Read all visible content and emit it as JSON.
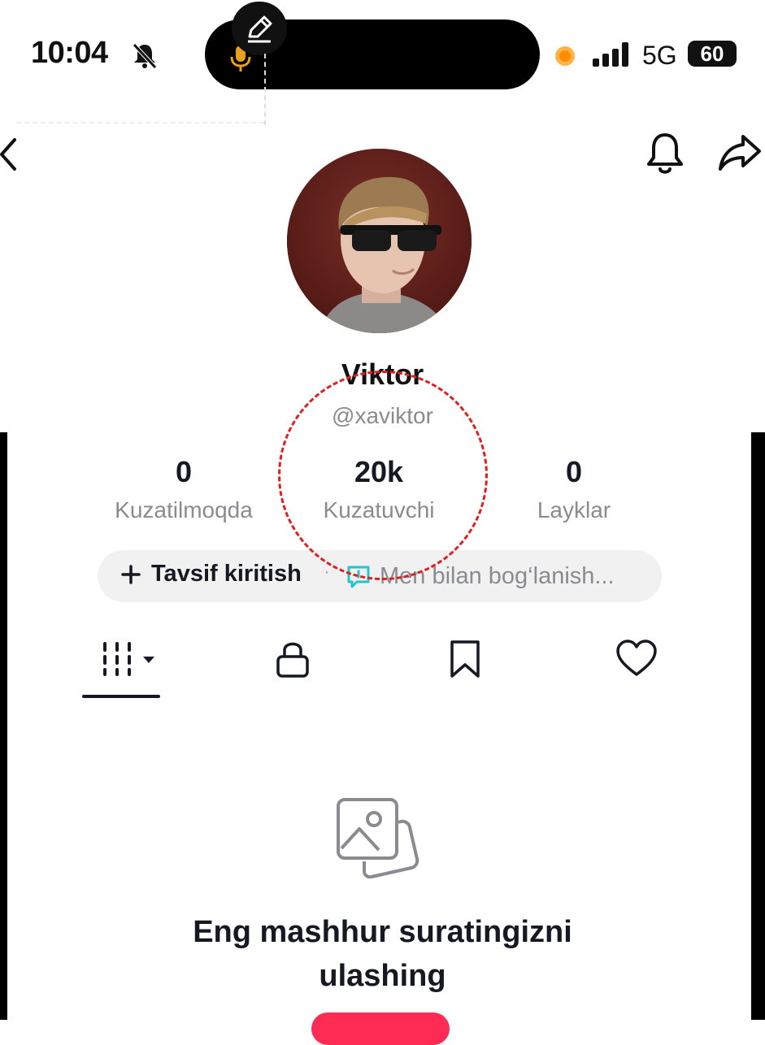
{
  "status_bar": {
    "time": "10:04",
    "network": "5G",
    "battery": "60",
    "icons": [
      "bell-slash-icon",
      "mic-icon",
      "pencil-icon",
      "recording-dot-icon",
      "signal-icon"
    ]
  },
  "header": {
    "icons": [
      "back-icon",
      "bell-icon",
      "share-icon"
    ]
  },
  "profile": {
    "display_name": "Viktor",
    "username": "@xaviktor",
    "stats": [
      {
        "value": "0",
        "label": "Kuzatilmoqda"
      },
      {
        "value": "20k",
        "label": "Kuzatuvchi"
      },
      {
        "value": "0",
        "label": "Layklar"
      }
    ],
    "add_bio_label": "Tavsif kiritish",
    "separator": "·",
    "contact_label": "Men bilan bog‘lanish..."
  },
  "tabs": [
    {
      "icon": "grid-icon",
      "active": true
    },
    {
      "icon": "lock-icon",
      "active": false
    },
    {
      "icon": "bookmark-icon",
      "active": false
    },
    {
      "icon": "heart-icon",
      "active": false
    }
  ],
  "empty_state": {
    "icon": "photos-icon",
    "title_line1": "Eng mashhur suratingizni",
    "title_line2": "ulashing"
  },
  "colors": {
    "accent": "#fe2c55",
    "annotation_red": "#e02020",
    "recording_orange": "#ff8c00",
    "text_primary": "#161823",
    "text_secondary": "#8a8b91"
  }
}
